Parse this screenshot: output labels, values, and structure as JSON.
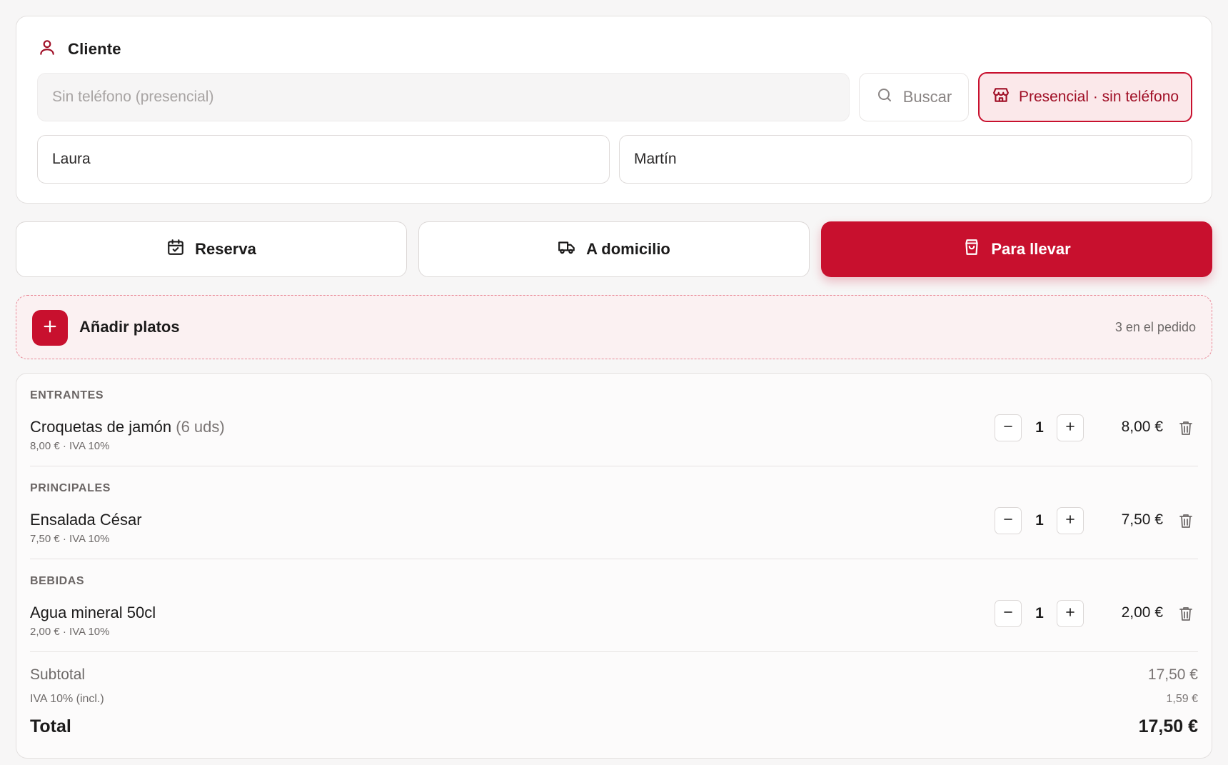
{
  "colors": {
    "accent": "#c8102e",
    "accent_soft": "#fbe8ea",
    "text": "#1c1b1b",
    "muted": "#6e6a69"
  },
  "client": {
    "title": "Cliente",
    "icon": "user-icon",
    "phone_placeholder": "Sin teléfono (presencial)",
    "search_label": "Buscar",
    "presencial_label": "Presencial · sin teléfono",
    "first_name": "Laura",
    "last_name": "Martín"
  },
  "order_types": [
    {
      "label": "Reserva",
      "icon": "calendar-check-icon",
      "active": false
    },
    {
      "label": "A domicilio",
      "icon": "truck-icon",
      "active": false
    },
    {
      "label": "Para llevar",
      "icon": "shopping-bag-icon",
      "active": true
    }
  ],
  "add_dishes": {
    "label": "Añadir platos",
    "count_text": "3 en el pedido"
  },
  "sections": [
    {
      "title": "ENTRANTES",
      "item": {
        "name": "Croquetas de jamón",
        "note": "(6 uds)",
        "meta": "8,00 € · IVA 10%",
        "qty": "1",
        "price": "8,00 €"
      }
    },
    {
      "title": "PRINCIPALES",
      "item": {
        "name": "Ensalada César",
        "note": "",
        "meta": "7,50 € · IVA 10%",
        "qty": "1",
        "price": "7,50 €"
      }
    },
    {
      "title": "BEBIDAS",
      "item": {
        "name": "Agua mineral 50cl",
        "note": "",
        "meta": "2,00 € · IVA 10%",
        "qty": "1",
        "price": "2,00 €"
      }
    }
  ],
  "totals": {
    "subtotal_label": "Subtotal",
    "subtotal_value": "17,50 €",
    "iva_label": "IVA 10% (incl.)",
    "iva_value": "1,59 €",
    "total_label": "Total",
    "total_value": "17,50 €"
  }
}
